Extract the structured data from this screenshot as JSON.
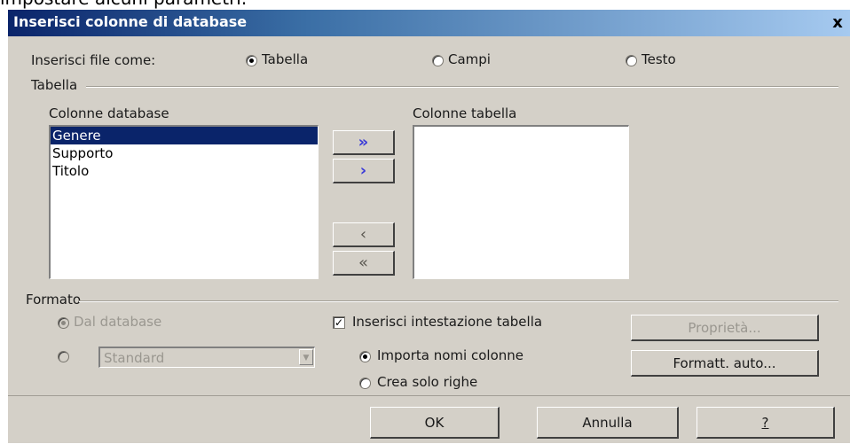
{
  "caption": "impostare alcuni parametri.",
  "dialog": {
    "title": "Inserisci colonne di database",
    "close_symbol": "x"
  },
  "insert_as": {
    "label": "Inserisci file come:",
    "options": [
      {
        "label": "Tabella",
        "checked": true
      },
      {
        "label": "Campi",
        "checked": false
      },
      {
        "label": "Testo",
        "checked": false
      }
    ]
  },
  "table_group": {
    "title": "Tabella",
    "db_columns_label": "Colonne database",
    "db_columns": [
      {
        "label": "Genere",
        "selected": true
      },
      {
        "label": "Supporto",
        "selected": false
      },
      {
        "label": "Titolo",
        "selected": false
      }
    ],
    "table_columns_label": "Colonne tabella",
    "table_columns": [],
    "buttons": {
      "move_all_right": "»",
      "move_right": "›",
      "move_left": "‹",
      "move_all_left": "«"
    }
  },
  "format_group": {
    "title": "Formato",
    "from_db_label": "Dal database",
    "custom_value": "Standard",
    "insert_header_label": "Inserisci intestazione tabella",
    "insert_header_checked": true,
    "import_names_label": "Importa nomi colonne",
    "only_rows_label": "Crea solo righe",
    "properties_button": "Proprietà...",
    "autoformat_button": "Formatt. auto..."
  },
  "footer": {
    "ok": "OK",
    "cancel": "Annulla",
    "help": "?"
  },
  "colors": {
    "dialog_bg": "#d4d0c8",
    "title_bar": "#0a246a",
    "selection": "#0a246a",
    "arrow_blue": "#3a3ad8"
  }
}
